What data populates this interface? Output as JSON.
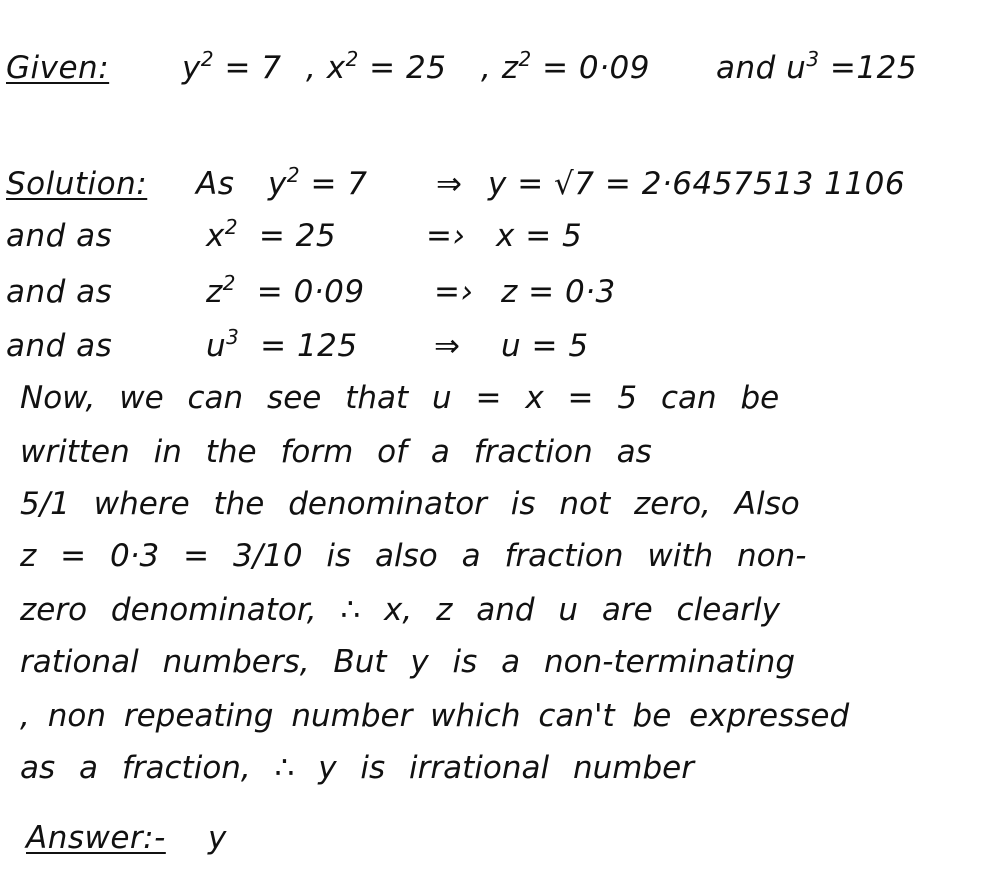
{
  "given": {
    "label": "Given:",
    "parts": [
      {
        "var": "y",
        "exp": "2",
        "rest": "= 7"
      },
      {
        "var": ", x",
        "exp": "2",
        "rest": "= 25"
      },
      {
        "var": ", z",
        "exp": "2",
        "rest": "= 0·09"
      },
      {
        "var": "and u",
        "exp": "3",
        "rest": "=125"
      }
    ]
  },
  "solution": {
    "label": "Solution:",
    "rows": [
      {
        "lead": "As",
        "var": "y",
        "exp": "2",
        "eq": "= 7",
        "arrow": "⇒",
        "result": "y = √7 = 2·6457513 1106"
      },
      {
        "lead": "and as",
        "var": "x",
        "exp": "2",
        "eq": "= 25",
        "arrow": "=›",
        "result": "x = 5"
      },
      {
        "lead": "and as",
        "var": "z",
        "exp": "2",
        "eq": "= 0·09",
        "arrow": "=›",
        "result": "z = 0·3"
      },
      {
        "lead": "and as",
        "var": "u",
        "exp": "3",
        "eq": "= 125",
        "arrow": "⇒",
        "result": "u = 5"
      }
    ]
  },
  "paragraph": [
    "Now, we can see that u = x = 5 can be",
    "written in the form of a fraction as",
    "5/1 where the denominator is not zero, Also",
    "z = 0·3 = 3/10 is also a fraction with non-",
    "zero denominator, ∴ x, z and u are clearly",
    "rational numbers, But y is a non-terminating",
    ", non repeating number which can't be expressed",
    "as a fraction, ∴ y is irrational number"
  ],
  "answer": {
    "label": "Answer:-",
    "value": "y"
  }
}
